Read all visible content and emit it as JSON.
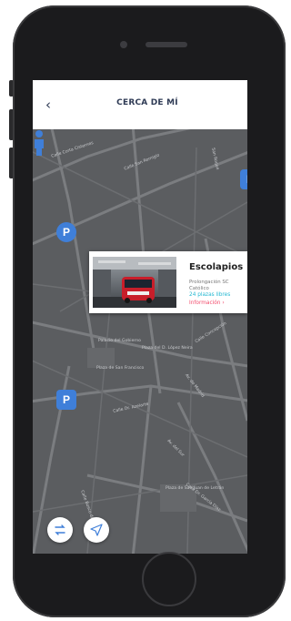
{
  "header": {
    "back_icon": "chevron-left-icon",
    "title": "CERCA DE MÍ"
  },
  "map": {
    "streets": [
      "Calle Corta Cisternes",
      "Calle San Remigio",
      "San Roque",
      "Calle Concepción",
      "Palacio del Gobierno",
      "Plaza de San Francisco",
      "Plaza del D. López Neira",
      "Calle Dr. Azelarte",
      "Av. de Madrid",
      "Av. del Sur",
      "Calle Dr. García Díaz",
      "Plaza de San Juan de Letrán",
      "Calle Bosco de Soria"
    ],
    "pins": [
      "P",
      "P",
      "P"
    ]
  },
  "card": {
    "title": "Escolapios",
    "address_line1": "Prolongación SC",
    "address_line2": "Católico",
    "free_spots": "24 plazas libres",
    "info_link": "Información ›"
  },
  "fabs": {
    "swap_icon": "swap-arrows-icon",
    "locate_icon": "navigation-arrow-icon"
  },
  "colors": {
    "accent": "#3f7fd9",
    "free": "#25b8d2",
    "info": "#f24a6b",
    "title": "#2f3b55",
    "map_bg": "#5b5d60"
  }
}
